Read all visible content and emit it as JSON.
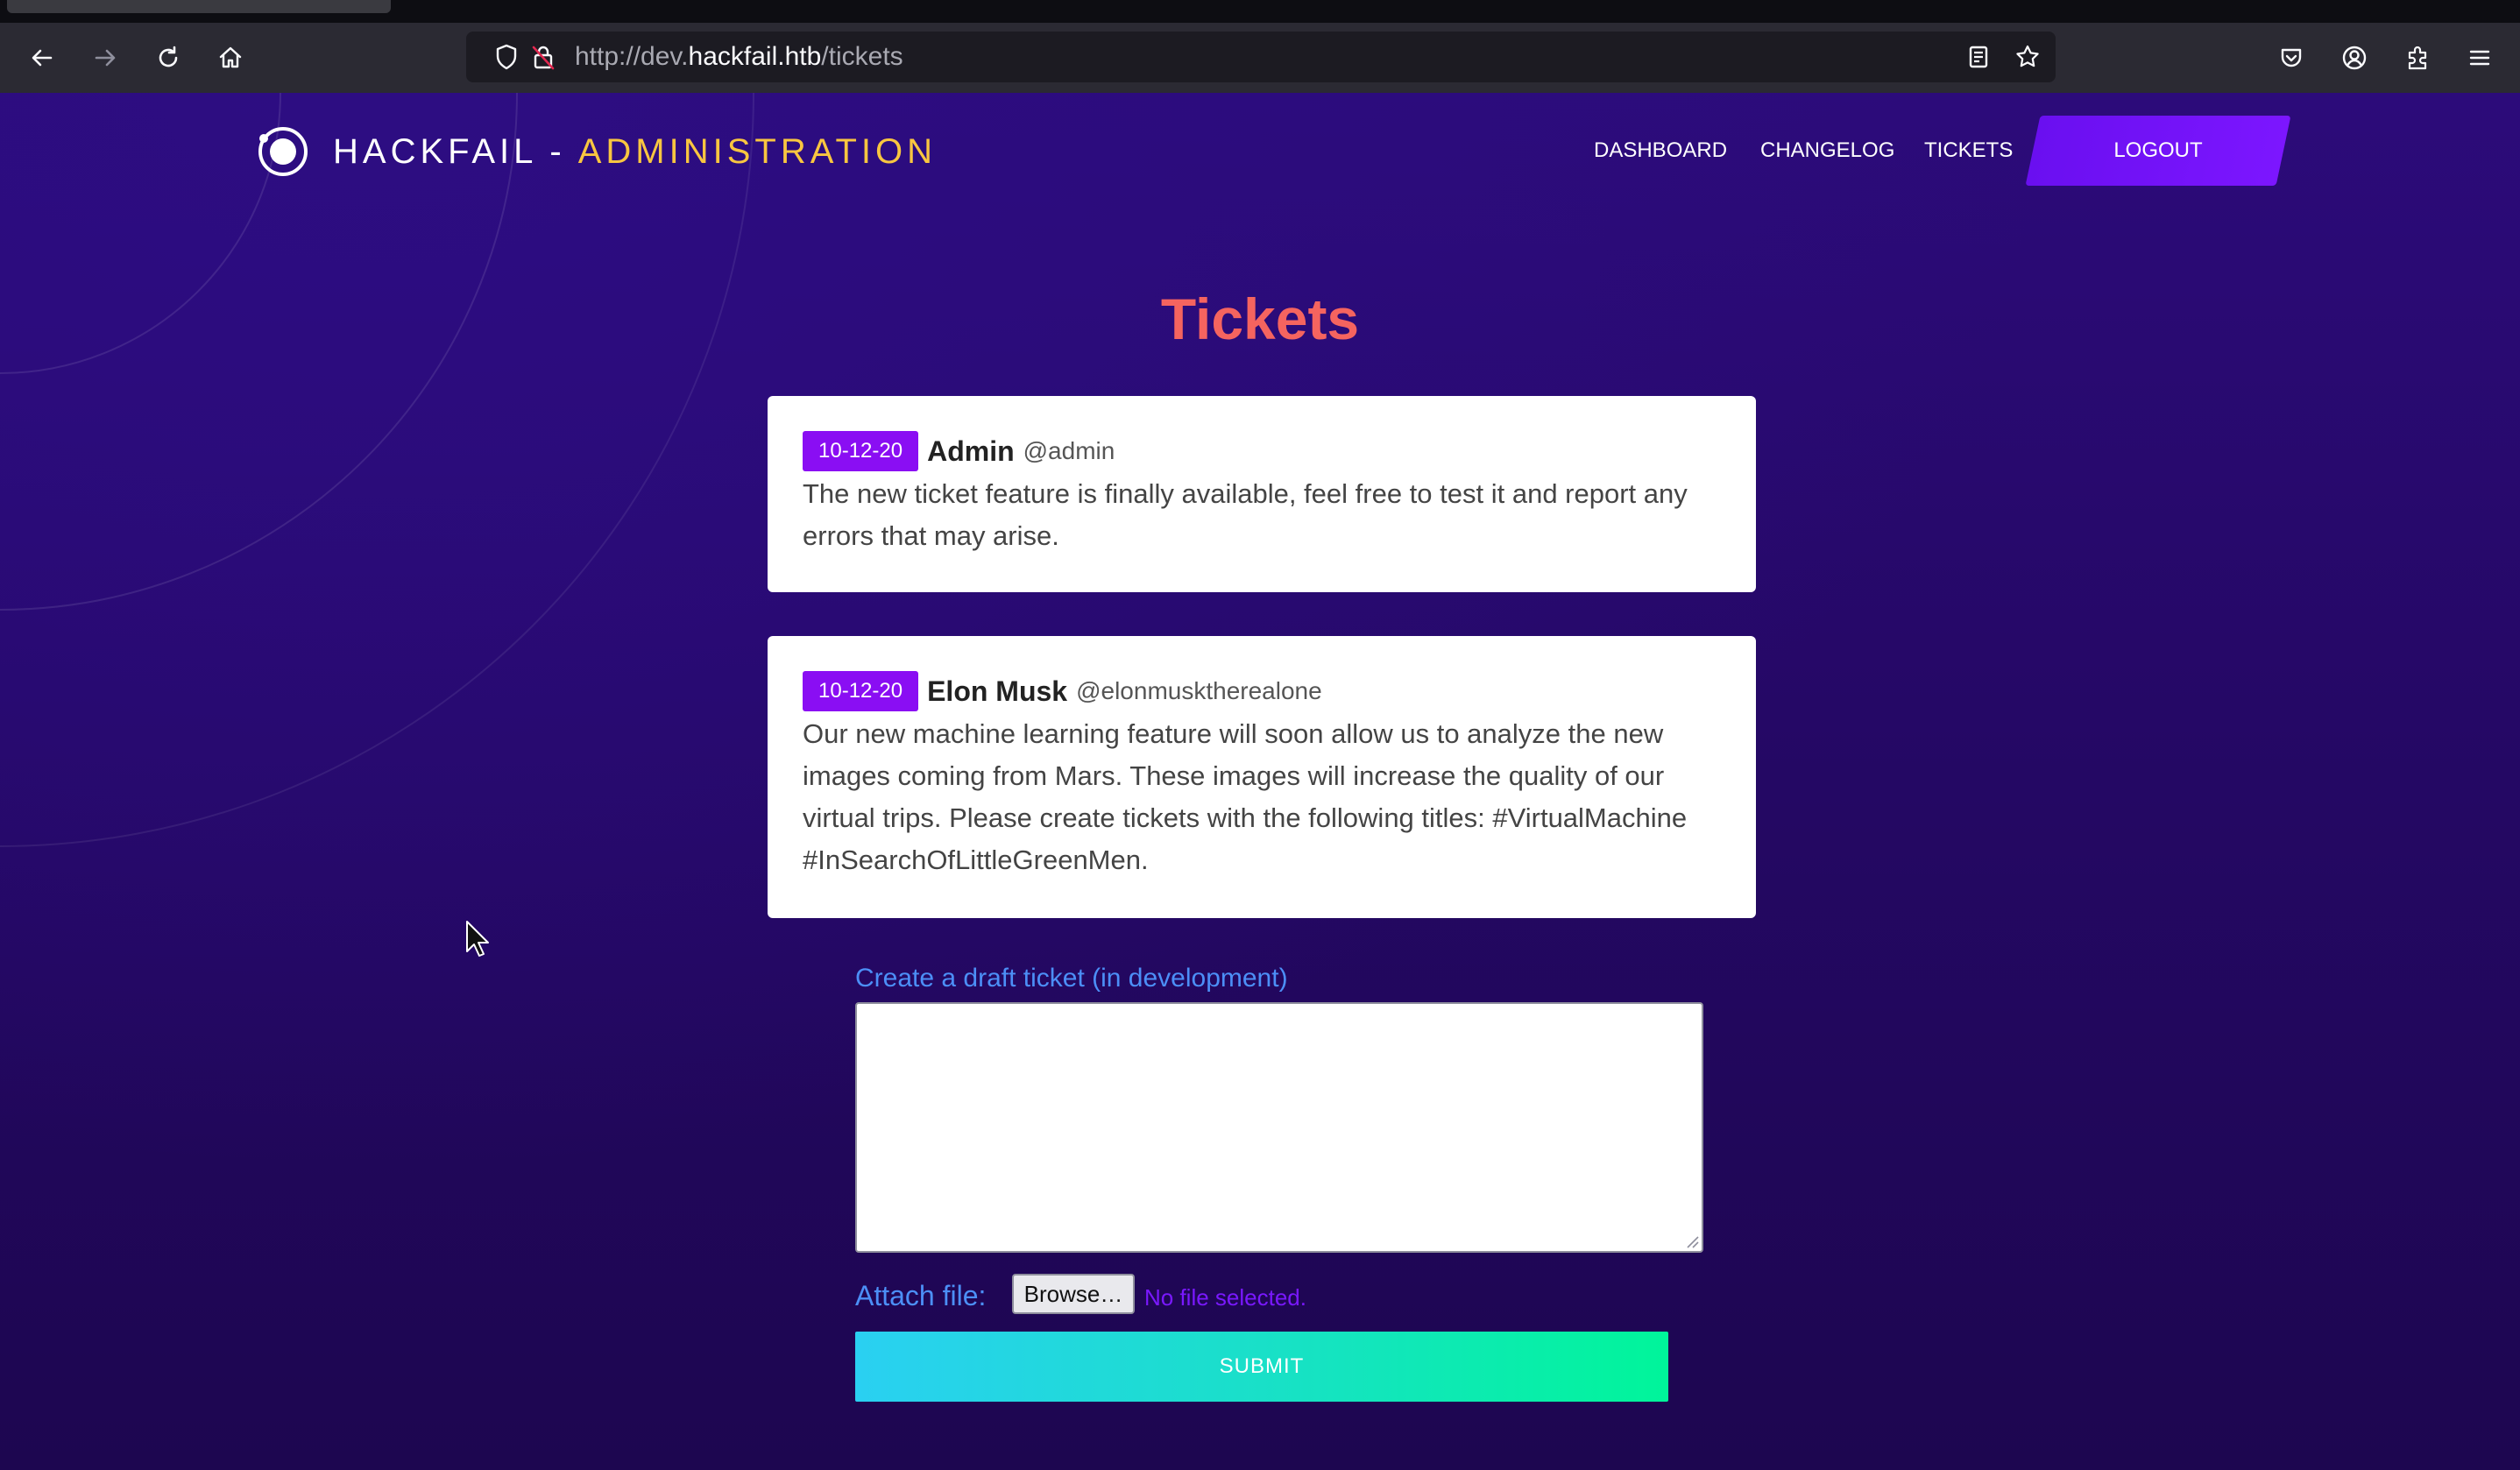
{
  "browser": {
    "url_prefix": "http://dev.",
    "url_host": "hackfail.htb",
    "url_path": "/tickets"
  },
  "site": {
    "brand_main": "HACKFAIL",
    "brand_sep": "-",
    "brand_accent": "ADMINISTRATION",
    "nav": {
      "dashboard": "DASHBOARD",
      "changelog": "CHANGELOG",
      "tickets": "TICKETS",
      "logout": "LOGOUT"
    }
  },
  "main": {
    "title": "Tickets",
    "tickets": [
      {
        "date": "10-12-20",
        "author": "Admin",
        "handle": "@admin",
        "body": "The new ticket feature is finally available, feel free to test it and report any errors that may arise."
      },
      {
        "date": "10-12-20",
        "author": "Elon Musk",
        "handle": "@elonmusktherealone",
        "body": "Our new machine learning feature will soon allow us to analyze the new images coming from Mars. These images will increase the quality of our virtual trips. Please create tickets with the following titles: #VirtualMachine #InSearchOfLittleGreenMen."
      }
    ],
    "draft": {
      "label": "Create a draft ticket (in development)",
      "value": "",
      "attach_label": "Attach file:",
      "browse_label": "Browse…",
      "no_file": "No file selected.",
      "submit_label": "SUBMIT"
    }
  },
  "colors": {
    "background": "#2a0a6e",
    "title": "#f5645f",
    "brand_accent": "#f9c640",
    "badge": "#8a0ef3",
    "logout": "#7c16ff",
    "label": "#4c8ff7",
    "submit_gradient": [
      "#2ad0f2",
      "#00f59a"
    ]
  }
}
